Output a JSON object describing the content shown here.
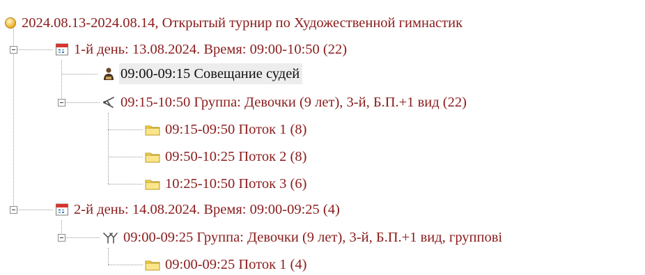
{
  "tree": {
    "root": {
      "label": "2024.08.13-2024.08.14, Открытый турнир по Художественной гимнастик",
      "icon": "event-circle-icon"
    },
    "day1": {
      "label": "1-й день: 13.08.2024. Время: 09:00-10:50 (22)",
      "icon": "calendar-icon",
      "meeting": {
        "label": "09:00-09:15 Совещание судей",
        "icon": "judge-person-icon"
      },
      "group": {
        "label": "09:15-10:50 Группа: Девочки (9 лет), 3-й, Б.П.+1 вид (22)",
        "icon": "gymnast-single-icon",
        "flows": [
          {
            "label": "09:15-09:50 Поток 1 (8)",
            "icon": "folder-icon"
          },
          {
            "label": "09:50-10:25 Поток 2 (8)",
            "icon": "folder-icon"
          },
          {
            "label": "10:25-10:50 Поток 3 (6)",
            "icon": "folder-icon"
          }
        ]
      }
    },
    "day2": {
      "label": "2-й день: 14.08.2024. Время: 09:00-09:25 (4)",
      "icon": "calendar-icon",
      "group": {
        "label": "09:00-09:25 Группа: Девочки (9 лет), 3-й, Б.П.+1 вид, группові",
        "icon": "gymnast-group-icon",
        "flows": [
          {
            "label": "09:00-09:25 Поток 1 (4)",
            "icon": "folder-icon"
          }
        ]
      }
    }
  },
  "colors": {
    "text": "#8a1c1c",
    "selected_bg": "#ededed",
    "root_icon": "#f2c12e",
    "folder": "#f6d64a",
    "calendar_header": "#d9342b"
  }
}
